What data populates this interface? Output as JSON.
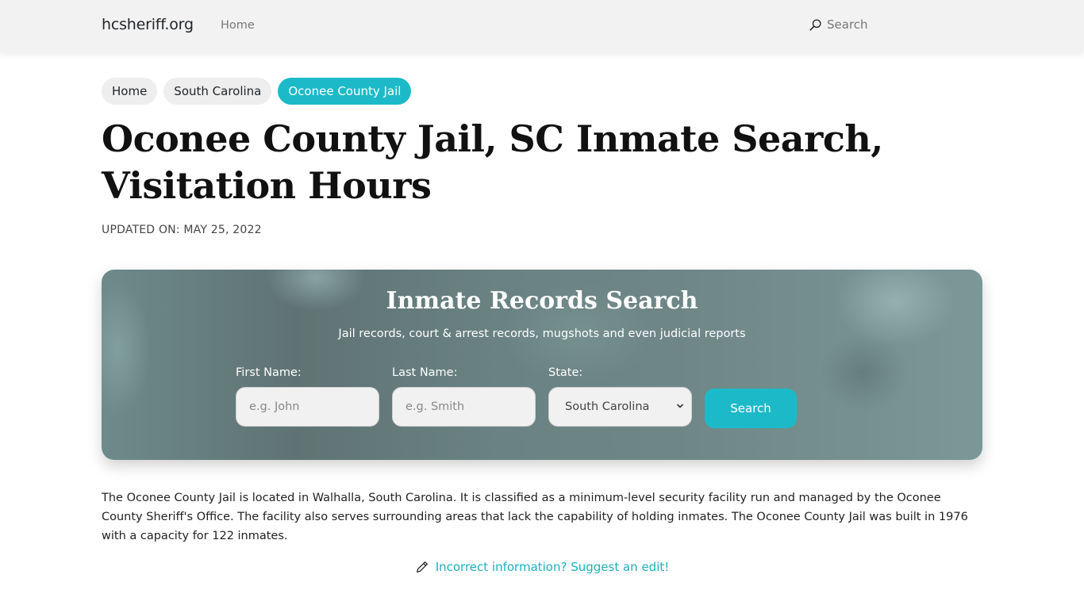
{
  "navbar": {
    "brand": "hcsheriff.org",
    "home_label": "Home",
    "search_label": "Search",
    "search_icon": "search-icon"
  },
  "breadcrumb": [
    {
      "label": "Home",
      "active": false
    },
    {
      "label": "South Carolina",
      "active": false
    },
    {
      "label": "Oconee County Jail",
      "active": true
    }
  ],
  "page": {
    "title": "Oconee County Jail, SC Inmate Search, Visitation Hours",
    "updated": "UPDATED ON: MAY 25, 2022"
  },
  "search_card": {
    "title": "Inmate Records Search",
    "subtitle": "Jail records, court & arrest records, mugshots and even judicial reports",
    "first_name": {
      "label": "First Name:",
      "placeholder": "e.g. John",
      "value": ""
    },
    "last_name": {
      "label": "Last Name:",
      "placeholder": "e.g. Smith",
      "value": ""
    },
    "state": {
      "label": "State:",
      "selected": "South Carolina"
    },
    "button_label": "Search"
  },
  "intro_text": "The Oconee County Jail is located in Walhalla, South Carolina. It is classified as a minimum-level security facility run and managed by the Oconee County Sheriff's Office. The facility also serves surrounding areas that lack the capability of holding inmates. The Oconee County Jail was built in 1976 with a capacity for 122 inmates.",
  "suggest_edit": {
    "label": "Incorrect information? Suggest an edit!",
    "icon": "pencil-icon"
  },
  "colors": {
    "accent": "#1cbac8",
    "navbar_bg": "#f2f2f2",
    "crumb_bg": "#eeeeee"
  }
}
